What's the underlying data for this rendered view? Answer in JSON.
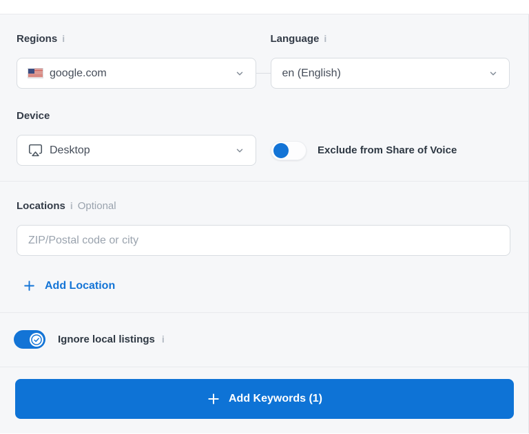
{
  "colors": {
    "accent_blue": "#1374d6",
    "button_blue": "#0e73d6",
    "label_text": "#333b47",
    "muted_text": "#9aa3ae",
    "field_border": "#d8dce1",
    "section_bg": "#f6f7f9",
    "divider": "#e8eaed"
  },
  "form": {
    "regions": {
      "label": "Regions",
      "info_icon": "i",
      "selected": "google.com",
      "flag_icon": "us-flag"
    },
    "language": {
      "label": "Language",
      "info_icon": "i",
      "selected": "en (English)"
    },
    "device": {
      "label": "Device",
      "selected": "Desktop",
      "icon": "desktop-icon"
    },
    "exclude_share_of_voice": {
      "label": "Exclude from Share of Voice",
      "state": "off"
    },
    "locations": {
      "label": "Locations",
      "info_icon": "i",
      "optional_badge": "Optional",
      "input_value": "",
      "input_placeholder": "ZIP/Postal code or city",
      "add_location_label": "Add Location"
    },
    "ignore_local_listings": {
      "label": "Ignore local listings",
      "info_icon": "i",
      "state": "on"
    },
    "add_keywords_button": {
      "label": "Add Keywords (1)"
    }
  }
}
